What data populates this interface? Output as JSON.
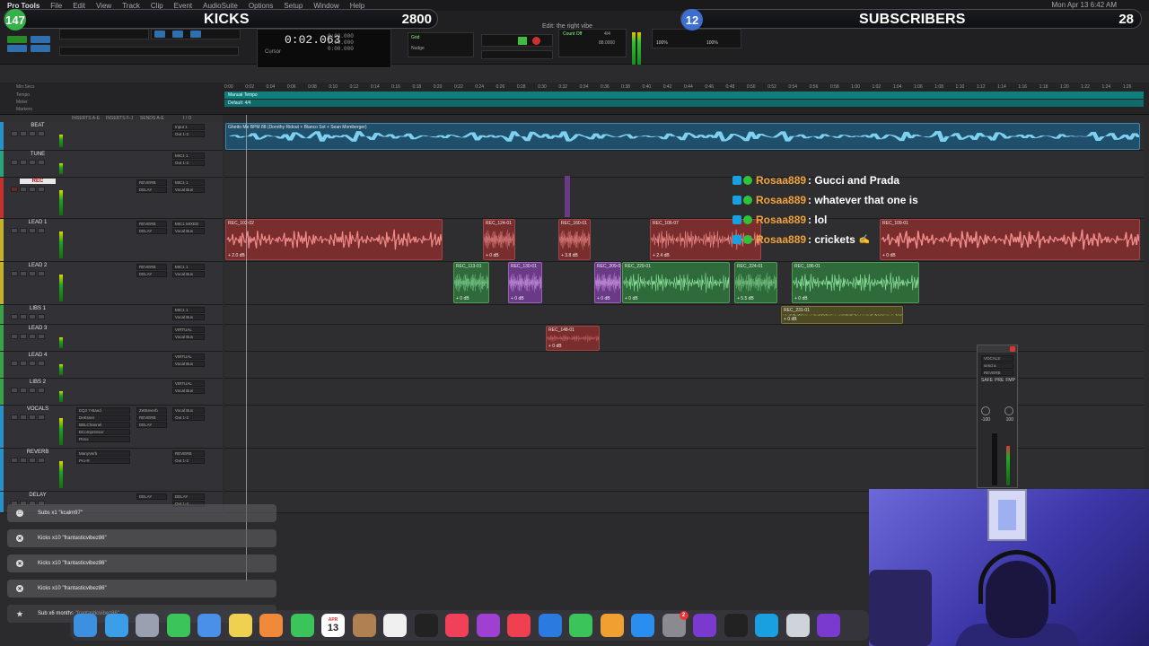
{
  "menubar": {
    "app": "Pro Tools",
    "items": [
      "File",
      "Edit",
      "View",
      "Track",
      "Clip",
      "Event",
      "AudioSuite",
      "Options",
      "Setup",
      "Window",
      "Help"
    ],
    "clock": "Mon Apr 13  6:42 AM"
  },
  "session": {
    "title": "Edit: the right vibe"
  },
  "counter": {
    "main": "0:02.063",
    "labels": "Cursor",
    "start": "0:00.000",
    "end": "0:00.000",
    "length": "0:00.000"
  },
  "toolbar": {
    "grid_label": "Grid",
    "nudge_label": "Nudge",
    "strength": "100%",
    "swing": "100%",
    "count_off": "Count Off",
    "meter": "4/4",
    "tempo": "88.0000"
  },
  "banners": {
    "kicks": {
      "count_left": "147",
      "title": "KICKS",
      "count_right": "2800"
    },
    "subscribers": {
      "count_left": "12",
      "title": "SUBSCRIBERS",
      "count_right": "28"
    }
  },
  "rulers": {
    "labels": [
      "Min:Secs",
      "Tempo",
      "Meter",
      "Markers"
    ],
    "tempo_text": "Manual Tempo",
    "meter_text": "Default: 4/4",
    "ticks": [
      "0:00",
      "0:02",
      "0:04",
      "0:06",
      "0:08",
      "0:10",
      "0:12",
      "0:14",
      "0:16",
      "0:18",
      "0:20",
      "0:22",
      "0:24",
      "0:26",
      "0:28",
      "0:30",
      "0:32",
      "0:34",
      "0:36",
      "0:38",
      "0:40",
      "0:42",
      "0:44",
      "0:46",
      "0:48",
      "0:50",
      "0:52",
      "0:54",
      "0:56",
      "0:58",
      "1:00",
      "1:02",
      "1:04",
      "1:06",
      "1:08",
      "1:10",
      "1:12",
      "1:14",
      "1:16",
      "1:18",
      "1:20",
      "1:22",
      "1:24",
      "1:26"
    ]
  },
  "mix_header": {
    "inserts_ae": "INSERTS A-E",
    "inserts_fj": "INSERTS F-J",
    "sends_ae": "SENDS A-E",
    "io": "I / O"
  },
  "tracks": [
    {
      "name": "BEAT",
      "color": "#2a8fc4",
      "selected": false,
      "inserts": [],
      "sends": [],
      "io": [
        "Input 1",
        "Out 1-2"
      ]
    },
    {
      "name": "TUNE",
      "color": "#2aa37a",
      "selected": false,
      "inserts": [],
      "sends": [],
      "io": [
        "MIC1 1",
        "Out 1-2"
      ]
    },
    {
      "name": "REC",
      "color": "#c43030",
      "selected": true,
      "inserts": [],
      "sends": [
        "REVERB",
        "DELAY"
      ],
      "io": [
        "MIC1 1",
        "Vocal Bus"
      ]
    },
    {
      "name": "LEAD 1",
      "color": "#c4b02a",
      "selected": false,
      "inserts": [],
      "sends": [
        "REVERB",
        "DELAY"
      ],
      "io": [
        "MIC1 MIXED",
        "Vocal Bus"
      ]
    },
    {
      "name": "LEAD 2",
      "color": "#c4b02a",
      "selected": false,
      "inserts": [],
      "sends": [
        "REVERB",
        "DELAY"
      ],
      "io": [
        "MIC1 1",
        "Vocal Bus"
      ]
    },
    {
      "name": "LIBS 1",
      "color": "#3aa04a",
      "selected": false,
      "inserts": [],
      "sends": [],
      "io": [
        "MIC1 1",
        "Vocal Bus"
      ]
    },
    {
      "name": "LEAD 3",
      "color": "#3aa04a",
      "selected": false,
      "inserts": [],
      "sends": [],
      "io": [
        "VIRTUAL",
        "Vocal Bus"
      ]
    },
    {
      "name": "LEAD 4",
      "color": "#3aa04a",
      "selected": false,
      "inserts": [],
      "sends": [],
      "io": [
        "VIRTUAL",
        "Vocal Bus"
      ]
    },
    {
      "name": "LIBS 2",
      "color": "#3aa04a",
      "selected": false,
      "inserts": [],
      "sends": [],
      "io": [
        "VIRTUAL",
        "Vocal Bus"
      ]
    },
    {
      "name": "VOCALS",
      "color": "#2a8fc4",
      "selected": false,
      "inserts": [
        "EQ3 7-Band",
        "DeEsser",
        "BBLChannel",
        "BCompressor",
        "RVox"
      ],
      "sends": [
        "ZetEeverb",
        "REVERB",
        "DELAY"
      ],
      "io": [
        "Vocal Bus",
        "Out 1-2"
      ]
    },
    {
      "name": "REVERB",
      "color": "#2a8fc4",
      "selected": false,
      "inserts": [
        "ManyVerb",
        "Pro-R"
      ],
      "sends": [],
      "io": [
        "REVERB",
        "Out 1-2"
      ]
    },
    {
      "name": "DELAY",
      "color": "#2a8fc4",
      "selected": false,
      "inserts": [],
      "sends": [
        "DELAY"
      ],
      "io": [
        "DELAY",
        "Out 1-2"
      ]
    }
  ],
  "clips": {
    "beat": "Ghetto Me BPM 88 (Dorothy Ridout + Blanco Sol + Sean Momberger)",
    "rec_lead1": [
      "REC_102-02",
      "REC_124-01",
      "REC_160-01",
      "REC_106-07",
      "REC_109-01"
    ],
    "rec_lead2": [
      "REC_113-01",
      "REC_130-01",
      "REC_209-0",
      "REC_229-01",
      "REC_224-01",
      "REC_186-01"
    ],
    "libs1": "REC_231-01",
    "lead3": "REC_148-01",
    "gains": [
      "+ 2.0 dB",
      "+ 0 dB",
      "+ 3.8 dB",
      "+ 2.4 dB",
      "+ 0 dB",
      "+ 0 dB",
      "+ 0 dB",
      "+ 0 dB",
      "+ 0 dB",
      "+ 5.5 dB",
      "+ 0 dB",
      "+ 0 dB",
      "+ 0 dB"
    ]
  },
  "chat": [
    {
      "user": "Rosaa889",
      "message": ": Gucci and Prada"
    },
    {
      "user": "Rosaa889",
      "message": ": whatever that one is"
    },
    {
      "user": "Rosaa889",
      "message": ": lol"
    },
    {
      "user": "Rosaa889",
      "message": ": crickets"
    }
  ],
  "mini_window": {
    "track": "VOCALS",
    "send": "send a",
    "dest": "REVERB",
    "safe": "SAFE",
    "pre": "PRE",
    "fmp": "FMP",
    "value1": "-100",
    "value2": "100"
  },
  "alerts": [
    {
      "icon": "calendar-icon",
      "text": "Subs x1 \"kcalm97\""
    },
    {
      "icon": "kick-icon",
      "text": "Kicks x10 \"frantasticvibez86\""
    },
    {
      "icon": "kick-icon",
      "text": "Kicks x10 \"frantasticvibez86\""
    },
    {
      "icon": "kick-icon",
      "text": "Kicks x10 \"frantasticvibez86\""
    },
    {
      "icon": "star-icon",
      "text": "Sub x6 months \"frantasticvibez86\""
    }
  ],
  "dock": {
    "calendar_month": "APR",
    "calendar_day": "13",
    "apps": [
      "Finder",
      "Safari",
      "Launchpad",
      "Messages",
      "Mail",
      "Notes",
      "Photos",
      "FaceTime",
      "Calendar",
      "Contacts",
      "Reminders",
      "TV",
      "Music",
      "Podcasts",
      "News",
      "Keynote",
      "Numbers",
      "Pages",
      "App Store",
      "System Preferences",
      "Pro Tools",
      "iLok",
      "Circle",
      "Disk Utility",
      "Avid"
    ],
    "badge": "2"
  }
}
